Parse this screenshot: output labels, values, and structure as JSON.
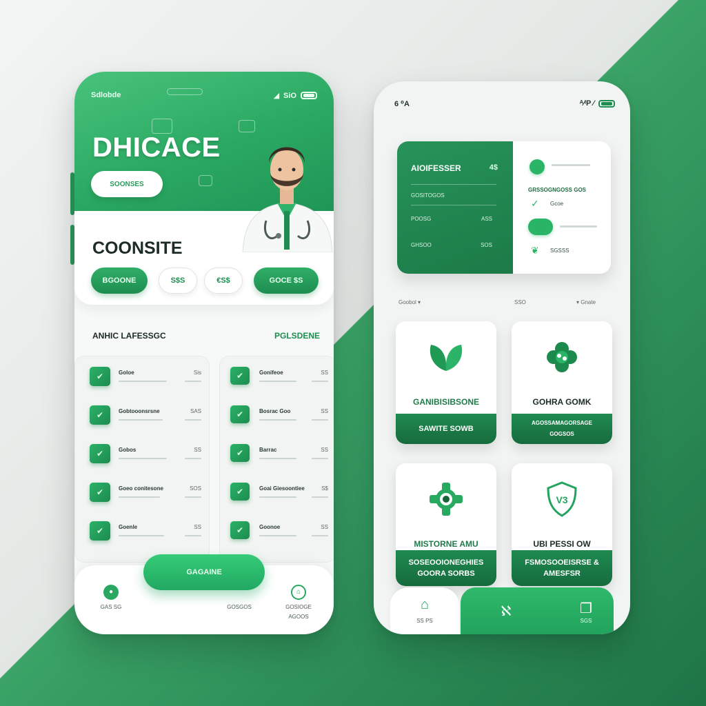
{
  "colors": {
    "brand_green": "#2aa862",
    "dark_green": "#1b7a47",
    "light_bg": "#f3f5f4"
  },
  "left": {
    "status": {
      "left": "Sdlobde",
      "right": "SiO"
    },
    "hero": {
      "title": "DHICACE",
      "pill": "SOONSES"
    },
    "consult": {
      "title": "COONSITE",
      "buttons": [
        {
          "label": "BGOONE"
        },
        {
          "label": "S$S"
        },
        {
          "label": "€S$"
        },
        {
          "label": "GOCE $S"
        }
      ]
    },
    "section": {
      "title": "ANHIC LAFESSGC",
      "link": "PGLSDENE"
    },
    "list_a": [
      {
        "title": "Goloe",
        "value": "Sis"
      },
      {
        "title": "Gobtooonsrsne",
        "value": "SAS"
      },
      {
        "title": "Gobos",
        "value": "SS"
      },
      {
        "title": "Goeo conitesone",
        "value": "SOS"
      },
      {
        "title": "Goenle",
        "value": "SS"
      }
    ],
    "list_b": [
      {
        "title": "Gonifeoe",
        "value": "SS"
      },
      {
        "title": "Bosrac Goo",
        "value": "SS"
      },
      {
        "title": "Barrac",
        "value": "SS"
      },
      {
        "title": "Goai Giesoontiee",
        "value": "S$"
      },
      {
        "title": "Goonoe",
        "value": "SS"
      }
    ],
    "cta": "GAGAINE",
    "nav": [
      {
        "label": "GAS SG",
        "icon": "home-icon"
      },
      {
        "label": "GOSIOGE",
        "icon": "user-icon"
      },
      {
        "label": "GOSGOS",
        "icon": "calendar-icon"
      },
      {
        "label": "AGOOS",
        "icon": "settings-icon"
      }
    ]
  },
  "right": {
    "status": {
      "left": "6 ⁰A",
      "right": "ᴬ⁄ᴵP ⁄"
    },
    "summary": {
      "title": "AIOIFESSER",
      "title_value": "4$",
      "rows": [
        {
          "label": "GOSITOGOS",
          "value": ""
        },
        {
          "label": "POOSG",
          "value": "ASS"
        },
        {
          "label": "GHSOO",
          "value": "SOS"
        }
      ],
      "side_header": "GRSSOGNGOSS GOS",
      "side_items": [
        "Gcoe",
        "SGSSS"
      ]
    },
    "filters": [
      "Goobol ▾",
      "SSO",
      "▾ Gnate"
    ],
    "tiles": [
      {
        "label": "GANIBISIBSONE",
        "foot": "SAWITE SOWB",
        "icon": "leaf-icon"
      },
      {
        "label": "GOHRA GOMK",
        "foot": "AGOSSAMAGORSAGE\nGOGSOS",
        "icon": "medical-flower-icon"
      },
      {
        "label": "MISTORNE AMU",
        "foot": "SOSEOOIONEGHIES\nGOORA SORBS",
        "icon": "gear-icon"
      },
      {
        "label": "UBI PESSI OW",
        "foot": "FSMOSOOEISRSE &\nAMESFSR",
        "icon": "shield-icon"
      }
    ],
    "nav": {
      "left_label": "SS PS",
      "right_label": "SGS"
    }
  }
}
